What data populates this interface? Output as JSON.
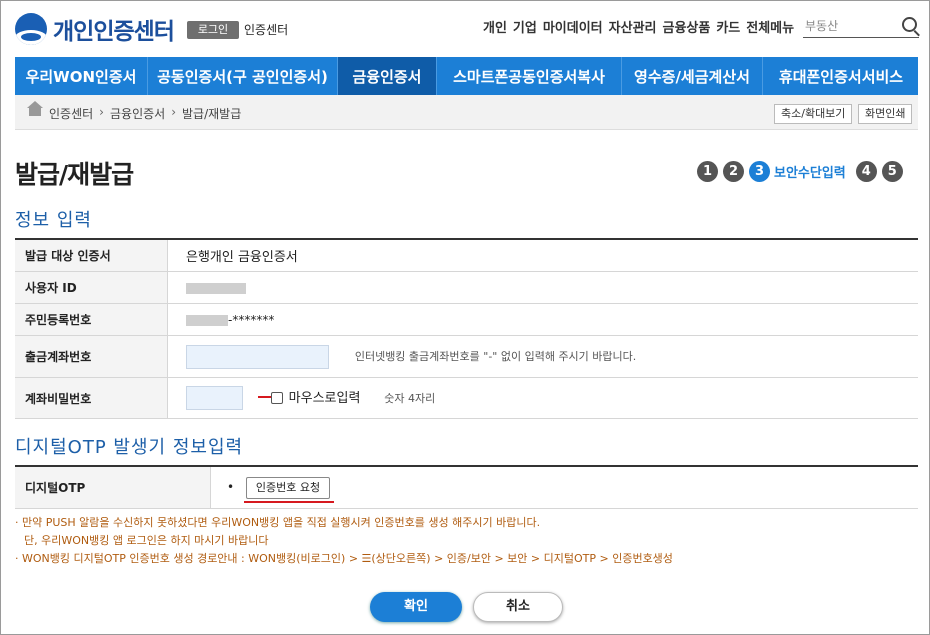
{
  "header": {
    "logo_text": "개인인증센터",
    "login_label": "로그인",
    "center_label": "인증센터",
    "top_menu": [
      "개인",
      "기업",
      "마이데이터",
      "자산관리",
      "금융상품",
      "카드",
      "전체메뉴"
    ],
    "search_placeholder": "부동산"
  },
  "main_nav": {
    "items": [
      "우리WON인증서",
      "공동인증서(구 공인인증서)",
      "금융인증서",
      "스마트폰공동인증서복사",
      "영수증/세금계산서",
      "휴대폰인증서서비스"
    ],
    "active_index": 2
  },
  "breadcrumb": {
    "items": [
      "인증센터",
      "금융인증서",
      "발급/재발급"
    ],
    "zoom_button": "축소/확대보기",
    "print_button": "화면인쇄"
  },
  "page_title": "발급/재발급",
  "steps": {
    "numbers": [
      "1",
      "2",
      "3",
      "4",
      "5"
    ],
    "active_number": "3",
    "active_label": "보안수단입력"
  },
  "info_section": {
    "title": "정보 입력",
    "rows": {
      "target_label": "발급 대상 인증서",
      "target_value": "은행개인 금융인증서",
      "user_id_label": "사용자 ID",
      "rrn_label": "주민등록번호",
      "rrn_suffix": "-*******",
      "account_label": "출금계좌번호",
      "account_hint": "인터넷뱅킹 출금계좌번호를 \"-\" 없이 입력해 주시기 바랍니다.",
      "pw_label": "계좌비밀번호",
      "mouse_input_label": "마우스로입력",
      "pw_hint": "숫자 4자리"
    }
  },
  "otp_section": {
    "title": "디지털OTP 발생기 정보입력",
    "label": "디지털OTP",
    "bullet": "•",
    "request_button": "인증번호 요청"
  },
  "notes": [
    "· 만약 PUSH 알람을 수신하지 못하셨다면 우리WON뱅킹 앱을 직접 실행시켜 인증번호를 생성 해주시기 바랍니다.",
    "  단, 우리WON뱅킹 앱 로그인은 하지 마시기 바랍니다",
    "· WON뱅킹 디지털OTP 인증번호 생성 경로안내 : WON뱅킹(비로그인) > ☰(상단오른쪽) > 인증/보안 > 보안 > 디지털OTP > 인증번호생성"
  ],
  "buttons": {
    "confirm": "확인",
    "cancel": "취소"
  },
  "colors": {
    "brand_blue": "#1c7fd6",
    "nav_active": "#0f5ca8",
    "section_title": "#1d5fa8",
    "note_text": "#b05c10",
    "highlight_red": "#d6191f"
  }
}
